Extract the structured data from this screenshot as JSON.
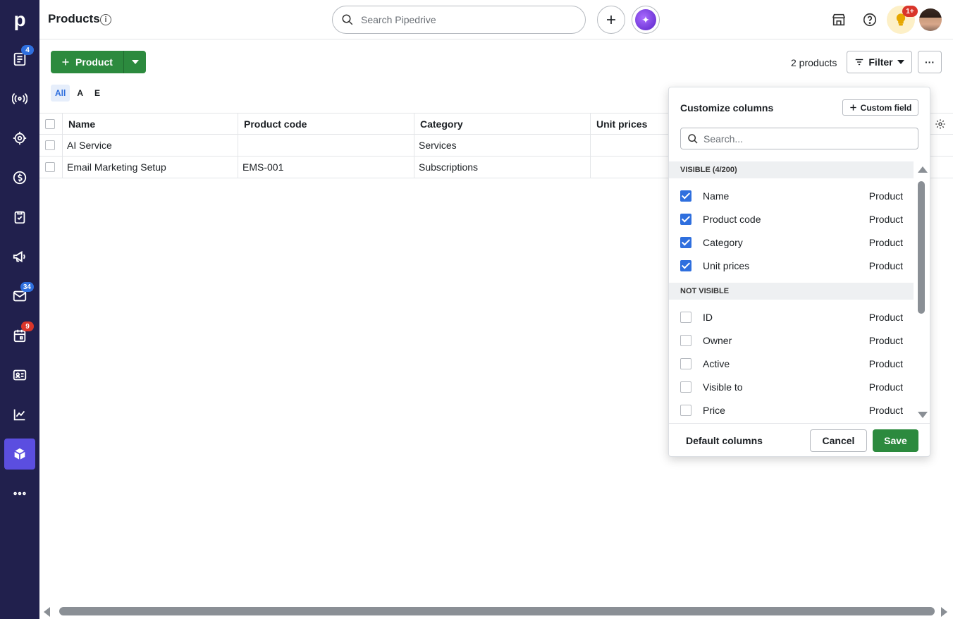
{
  "app": {
    "logo": "p"
  },
  "sidebar": {
    "items": [
      {
        "name": "leads-icon",
        "badge": "4",
        "badge_color": "blue"
      },
      {
        "name": "activity-radar-icon",
        "badge": null
      },
      {
        "name": "target-icon",
        "badge": null
      },
      {
        "name": "deals-dollar-icon",
        "badge": null
      },
      {
        "name": "clipboard-check-icon",
        "badge": null
      },
      {
        "name": "megaphone-icon",
        "badge": null
      },
      {
        "name": "mail-icon",
        "badge": "34",
        "badge_color": "blue"
      },
      {
        "name": "calendar-icon",
        "badge": "9",
        "badge_color": "red"
      },
      {
        "name": "contacts-card-icon",
        "badge": null
      },
      {
        "name": "insights-chart-icon",
        "badge": null
      },
      {
        "name": "products-box-icon",
        "badge": null,
        "active": true
      },
      {
        "name": "more-dots-icon",
        "badge": null
      }
    ]
  },
  "header": {
    "title": "Products",
    "search_placeholder": "Search Pipedrive",
    "notification_badge": "1+"
  },
  "toolbar": {
    "add_label": "Product",
    "count": "2 products",
    "filter_label": "Filter",
    "more_label": "···",
    "letters": [
      "All",
      "A",
      "E"
    ]
  },
  "table": {
    "columns": [
      "Name",
      "Product code",
      "Category",
      "Unit prices"
    ],
    "rows": [
      {
        "name": "AI Service",
        "code": "",
        "category": "Services",
        "price": ""
      },
      {
        "name": "Email Marketing Setup",
        "code": "EMS-001",
        "category": "Subscriptions",
        "price": ""
      }
    ]
  },
  "panel": {
    "title": "Customize columns",
    "custom_field_label": "Custom field",
    "search_placeholder": "Search...",
    "visible_header": "VISIBLE (4/200)",
    "not_visible_header": "NOT VISIBLE",
    "visible": [
      {
        "name": "Name",
        "type": "Product"
      },
      {
        "name": "Product code",
        "type": "Product"
      },
      {
        "name": "Category",
        "type": "Product"
      },
      {
        "name": "Unit prices",
        "type": "Product"
      }
    ],
    "not_visible": [
      {
        "name": "ID",
        "type": "Product"
      },
      {
        "name": "Owner",
        "type": "Product"
      },
      {
        "name": "Active",
        "type": "Product"
      },
      {
        "name": "Visible to",
        "type": "Product"
      },
      {
        "name": "Price",
        "type": "Product"
      }
    ],
    "default_label": "Default columns",
    "cancel_label": "Cancel",
    "save_label": "Save"
  },
  "colors": {
    "sidebar_bg": "#21204d",
    "accent_green": "#2c8a3e",
    "accent_blue": "#2f6fde",
    "active_nav": "#5b4ee0"
  }
}
